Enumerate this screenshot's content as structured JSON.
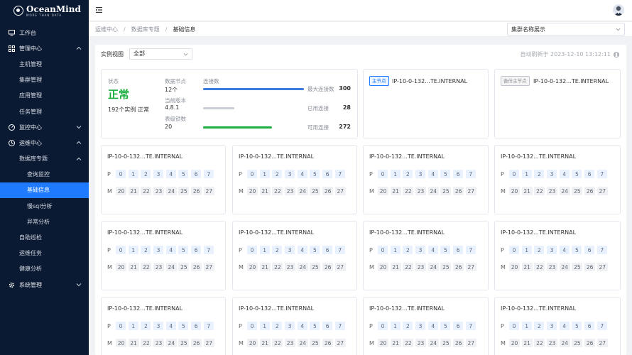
{
  "app": {
    "logo_title": "OceanMind",
    "logo_subtitle": "MORE THAN DATA"
  },
  "sidebar": {
    "items": [
      {
        "label": "工作台",
        "level": 1,
        "icon": "monitor-icon",
        "chevron": ""
      },
      {
        "label": "管理中心",
        "level": 1,
        "icon": "grid-icon",
        "chevron": "up"
      },
      {
        "label": "主机管理",
        "level": 2,
        "chevron": ""
      },
      {
        "label": "集群管理",
        "level": 2,
        "chevron": ""
      },
      {
        "label": "应用管理",
        "level": 2,
        "chevron": ""
      },
      {
        "label": "任务管理",
        "level": 2,
        "chevron": ""
      },
      {
        "label": "监控中心",
        "level": 1,
        "icon": "gauge-icon",
        "chevron": "down"
      },
      {
        "label": "运维中心",
        "level": 1,
        "icon": "clock-icon",
        "chevron": "up"
      },
      {
        "label": "数据库专题",
        "level": 2,
        "chevron": "up"
      },
      {
        "label": "查询监控",
        "level": 3,
        "chevron": ""
      },
      {
        "label": "基础信息",
        "level": 3,
        "chevron": "",
        "active": true
      },
      {
        "label": "慢sql分析",
        "level": 3,
        "chevron": ""
      },
      {
        "label": "异常分析",
        "level": 3,
        "chevron": ""
      },
      {
        "label": "自助巡检",
        "level": 2,
        "chevron": ""
      },
      {
        "label": "运维任务",
        "level": 2,
        "chevron": ""
      },
      {
        "label": "健康分析",
        "level": 2,
        "chevron": ""
      },
      {
        "label": "系统管理",
        "level": 1,
        "icon": "gear-icon",
        "chevron": "down"
      }
    ]
  },
  "breadcrumb": {
    "items": [
      "运维中心",
      "数据库专题",
      "基础信息"
    ],
    "separator": "/"
  },
  "cluster_select": {
    "value": "集群名称展示"
  },
  "toolbar": {
    "view_label": "实例视图",
    "view_value": "全部",
    "refresh_text": "自动刷新于 2023-12-10 13:12:11"
  },
  "status": {
    "status_label": "状态",
    "status_value": "正常",
    "instances_text": "192个实例",
    "instances_status": "正常",
    "data_nodes_label": "数据节点",
    "data_nodes_value": "12个",
    "version_label": "当前版本",
    "version_value": "4.8.1",
    "locks_label": "表级锁数",
    "locks_value": "20",
    "conn_label": "连接数",
    "max_conn_label": "最大连接数",
    "max_conn_value": "300",
    "used_conn_label": "已用连接",
    "used_conn_value": "28",
    "avail_conn_label": "可用连接",
    "avail_conn_value": "272",
    "bars": [
      {
        "fill_fraction": 1.0,
        "color": "#3a7be0"
      },
      {
        "fill_fraction": 0.31,
        "color": "#c9ced6"
      },
      {
        "fill_fraction": 0.68,
        "color": "#1aad3f"
      }
    ]
  },
  "node_cards": [
    {
      "tag": "主节点",
      "tag_type": "master",
      "title": "IP-10-0-132...TE.INTERNAL"
    },
    {
      "tag": "备份主节点",
      "tag_type": "backup",
      "title": "IP-10-0-132...TE.INTERNAL"
    }
  ],
  "instance_grid": {
    "title": "IP-10-0-132...TE.INTERNAL",
    "p_label": "P",
    "m_label": "M",
    "p_cells": [
      "0",
      "1",
      "2",
      "3",
      "4",
      "5",
      "6",
      "7"
    ],
    "m_cells": [
      "20",
      "21",
      "22",
      "23",
      "24",
      "25",
      "26",
      "27"
    ]
  },
  "colors": {
    "sidebar_bg": "#0b1a33",
    "accent": "#1e7bff",
    "success": "#1aad3f"
  }
}
